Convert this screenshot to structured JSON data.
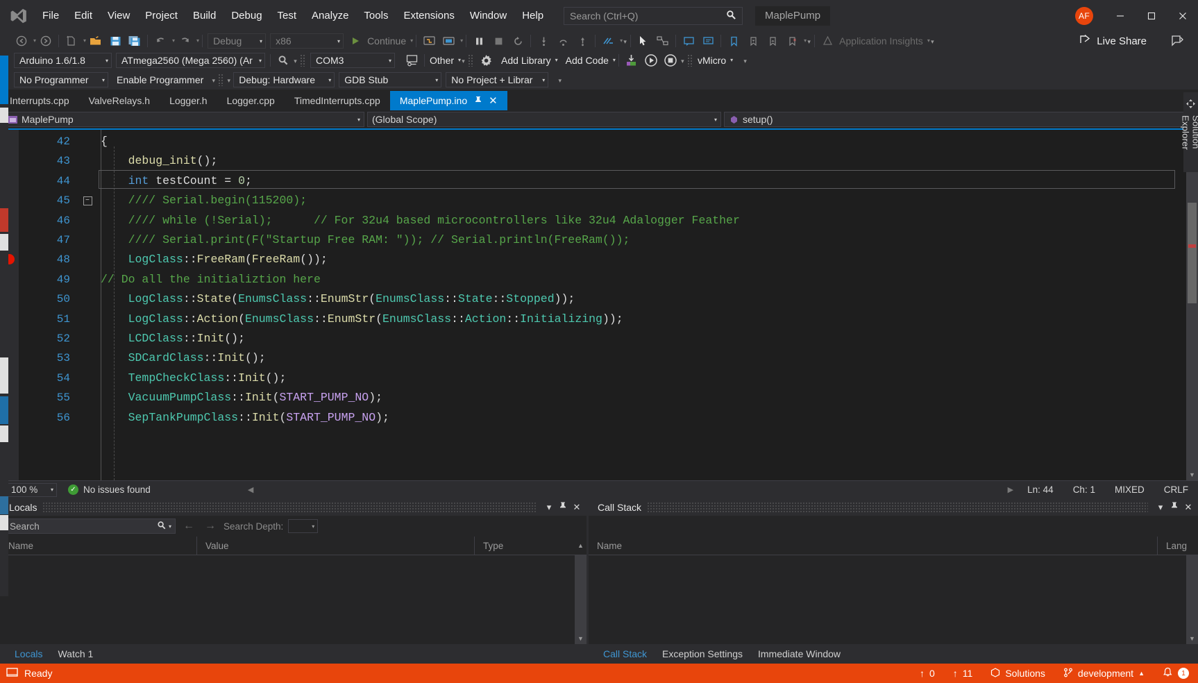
{
  "titlebar": {
    "logo": "vs-logo",
    "menu": [
      "File",
      "Edit",
      "View",
      "Project",
      "Build",
      "Debug",
      "Test",
      "Analyze",
      "Tools",
      "Extensions",
      "Window",
      "Help"
    ],
    "search_placeholder": "Search (Ctrl+Q)",
    "solution_name": "MaplePump",
    "avatar_initials": "AF",
    "window_minimize": "—",
    "window_maximize": "❐",
    "window_close": "✕"
  },
  "toolbar_standard": {
    "nav_back": "nav-back",
    "nav_forward": "nav-forward",
    "new_item": "new-item",
    "open_file": "open-file",
    "save": "save",
    "save_all": "save-all",
    "undo": "undo",
    "redo": "redo",
    "config": "Debug",
    "platform": "x86",
    "continue": "Continue",
    "live_share": "Live Share",
    "app_insights": "Application Insights"
  },
  "toolbar_vmicro": {
    "ide_version": "Arduino 1.6/1.8",
    "board": "ATmega2560 (Mega 2560) (Ar",
    "port": "COM3",
    "other": "Other",
    "add_library": "Add Library",
    "add_code": "Add Code",
    "vmicro": "vMicro",
    "programmer": "No Programmer ",
    "enable_programmer": "Enable Programmer",
    "debug_mode": "Debug: Hardware",
    "debugger": "GDB Stub",
    "build_scope": "No Project + Librar"
  },
  "tabs": [
    {
      "label": "Interrupts.cpp",
      "active": false
    },
    {
      "label": "ValveRelays.h",
      "active": false
    },
    {
      "label": "Logger.h",
      "active": false
    },
    {
      "label": "Logger.cpp",
      "active": false
    },
    {
      "label": "TimedInterrupts.cpp",
      "active": false
    },
    {
      "label": "MaplePump.ino",
      "active": true
    }
  ],
  "navbar": {
    "project": "MaplePump",
    "scope": "(Global Scope)",
    "member": "setup()"
  },
  "editor": {
    "lines": [
      {
        "num": "42",
        "tokens": [
          {
            "t": "{",
            "c": "t-punc"
          }
        ]
      },
      {
        "num": "43",
        "tokens": [
          {
            "t": "    ",
            "c": "t-plain"
          },
          {
            "t": "debug_init",
            "c": "t-fn"
          },
          {
            "t": "();",
            "c": "t-punc"
          }
        ]
      },
      {
        "num": "44",
        "tokens": [
          {
            "t": "    ",
            "c": "t-plain"
          },
          {
            "t": "int",
            "c": "t-kw"
          },
          {
            "t": " testCount = ",
            "c": "t-plain"
          },
          {
            "t": "0",
            "c": "t-num"
          },
          {
            "t": ";",
            "c": "t-punc"
          }
        ]
      },
      {
        "num": "45",
        "tokens": [
          {
            "t": "    //// Serial.begin(115200);",
            "c": "t-cmt"
          }
        ]
      },
      {
        "num": "46",
        "tokens": [
          {
            "t": "    //// while (!Serial);      // For 32u4 based microcontrollers like 32u4 Adalogger Feather",
            "c": "t-cmt"
          }
        ]
      },
      {
        "num": "47",
        "tokens": [
          {
            "t": "    //// Serial.print(F(\"Startup Free RAM: \")); // Serial.println(FreeRam());",
            "c": "t-cmt"
          }
        ]
      },
      {
        "num": "48",
        "tokens": [
          {
            "t": "    ",
            "c": "t-plain"
          },
          {
            "t": "LogClass",
            "c": "t-type"
          },
          {
            "t": "::",
            "c": "t-punc"
          },
          {
            "t": "FreeRam",
            "c": "t-fn"
          },
          {
            "t": "(",
            "c": "t-punc"
          },
          {
            "t": "FreeRam",
            "c": "t-fn"
          },
          {
            "t": "());",
            "c": "t-punc"
          }
        ]
      },
      {
        "num": "49",
        "tokens": [
          {
            "t": "// Do all the initializtion here",
            "c": "t-cmt"
          }
        ]
      },
      {
        "num": "50",
        "tokens": [
          {
            "t": "    ",
            "c": "t-plain"
          },
          {
            "t": "LogClass",
            "c": "t-type"
          },
          {
            "t": "::",
            "c": "t-punc"
          },
          {
            "t": "State",
            "c": "t-fn"
          },
          {
            "t": "(",
            "c": "t-punc"
          },
          {
            "t": "EnumsClass",
            "c": "t-type"
          },
          {
            "t": "::",
            "c": "t-punc"
          },
          {
            "t": "EnumStr",
            "c": "t-fn"
          },
          {
            "t": "(",
            "c": "t-punc"
          },
          {
            "t": "EnumsClass",
            "c": "t-type"
          },
          {
            "t": "::",
            "c": "t-punc"
          },
          {
            "t": "State",
            "c": "t-type"
          },
          {
            "t": "::",
            "c": "t-punc"
          },
          {
            "t": "Stopped",
            "c": "t-type"
          },
          {
            "t": "));",
            "c": "t-punc"
          }
        ]
      },
      {
        "num": "51",
        "tokens": [
          {
            "t": "    ",
            "c": "t-plain"
          },
          {
            "t": "LogClass",
            "c": "t-type"
          },
          {
            "t": "::",
            "c": "t-punc"
          },
          {
            "t": "Action",
            "c": "t-fn"
          },
          {
            "t": "(",
            "c": "t-punc"
          },
          {
            "t": "EnumsClass",
            "c": "t-type"
          },
          {
            "t": "::",
            "c": "t-punc"
          },
          {
            "t": "EnumStr",
            "c": "t-fn"
          },
          {
            "t": "(",
            "c": "t-punc"
          },
          {
            "t": "EnumsClass",
            "c": "t-type"
          },
          {
            "t": "::",
            "c": "t-punc"
          },
          {
            "t": "Action",
            "c": "t-type"
          },
          {
            "t": "::",
            "c": "t-punc"
          },
          {
            "t": "Initializing",
            "c": "t-type"
          },
          {
            "t": "));",
            "c": "t-punc"
          }
        ]
      },
      {
        "num": "52",
        "tokens": [
          {
            "t": "    ",
            "c": "t-plain"
          },
          {
            "t": "LCDClass",
            "c": "t-type"
          },
          {
            "t": "::",
            "c": "t-punc"
          },
          {
            "t": "Init",
            "c": "t-fn"
          },
          {
            "t": "();",
            "c": "t-punc"
          }
        ]
      },
      {
        "num": "53",
        "tokens": [
          {
            "t": "    ",
            "c": "t-plain"
          },
          {
            "t": "SDCardClass",
            "c": "t-type"
          },
          {
            "t": "::",
            "c": "t-punc"
          },
          {
            "t": "Init",
            "c": "t-fn"
          },
          {
            "t": "();",
            "c": "t-punc"
          }
        ]
      },
      {
        "num": "54",
        "tokens": [
          {
            "t": "    ",
            "c": "t-plain"
          },
          {
            "t": "TempCheckClass",
            "c": "t-type"
          },
          {
            "t": "::",
            "c": "t-punc"
          },
          {
            "t": "Init",
            "c": "t-fn"
          },
          {
            "t": "();",
            "c": "t-punc"
          }
        ]
      },
      {
        "num": "55",
        "tokens": [
          {
            "t": "    ",
            "c": "t-plain"
          },
          {
            "t": "VacuumPumpClass",
            "c": "t-type"
          },
          {
            "t": "::",
            "c": "t-punc"
          },
          {
            "t": "Init",
            "c": "t-fn"
          },
          {
            "t": "(",
            "c": "t-punc"
          },
          {
            "t": "START_PUMP_NO",
            "c": "t-macro"
          },
          {
            "t": ");",
            "c": "t-punc"
          }
        ]
      },
      {
        "num": "56",
        "tokens": [
          {
            "t": "    ",
            "c": "t-plain"
          },
          {
            "t": "SepTankPumpClass",
            "c": "t-type"
          },
          {
            "t": "::",
            "c": "t-punc"
          },
          {
            "t": "Init",
            "c": "t-fn"
          },
          {
            "t": "(",
            "c": "t-punc"
          },
          {
            "t": "START_PUMP_NO",
            "c": "t-macro"
          },
          {
            "t": ");",
            "c": "t-punc"
          }
        ]
      }
    ],
    "current_line_index": 2,
    "breakpoint_line_index": 6,
    "fold_line_index": 3
  },
  "editor_status": {
    "zoom": "100 %",
    "issues": "No issues found",
    "line": "Ln: 44",
    "ch": "Ch: 1",
    "encoding": "MIXED",
    "eol": "CRLF"
  },
  "locals_pane": {
    "title": "Locals",
    "search_placeholder": "Search",
    "search_depth_label": "Search Depth:",
    "search_depth_value": "",
    "columns": [
      "Name",
      "Value",
      "Type"
    ],
    "rows": [],
    "tabs": [
      {
        "label": "Locals",
        "active": true
      },
      {
        "label": "Watch 1",
        "active": false
      }
    ]
  },
  "callstack_pane": {
    "title": "Call Stack",
    "columns": [
      "Name",
      "Lang"
    ],
    "rows": [],
    "tabs": [
      {
        "label": "Call Stack",
        "active": true
      },
      {
        "label": "Exception Settings",
        "active": false
      },
      {
        "label": "Immediate Window",
        "active": false
      }
    ]
  },
  "statusbar": {
    "state": "Ready",
    "pending_changes": "0",
    "unpushed": "11",
    "solutions": "Solutions",
    "branch": "development",
    "notifications": "1"
  },
  "solution_explorer": {
    "label": "Solution Explorer"
  },
  "colors": {
    "accent": "#007acc",
    "statusbar": "#e8450c",
    "comment": "#57a64a",
    "type": "#4ec9b0",
    "keyword": "#569cd6",
    "function": "#dcdcaa",
    "macro": "#c8a2f0",
    "linenumber": "#3f96d2",
    "breakpoint": "#e51400"
  }
}
